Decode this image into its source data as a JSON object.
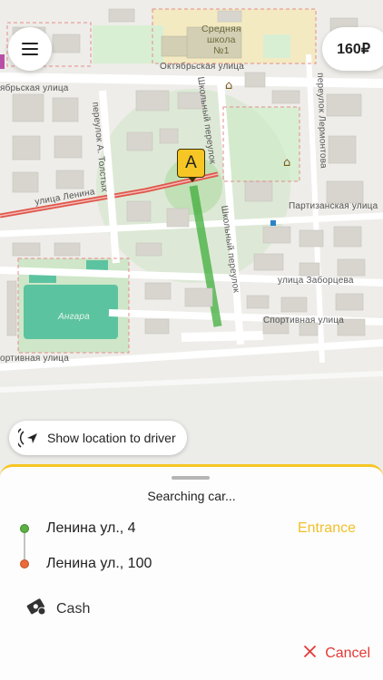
{
  "map": {
    "streets": {
      "oktyabrskaya": "Октябрьская улица",
      "oktyabrskaya_left": "ябрьская улица",
      "shkolny_top": "Школьный переулок",
      "shkolny_bottom": "Школьный переулок",
      "lermontova": "переулок Лермонтова",
      "tolstykh": "переулок А. Толстых",
      "lenina": "улица Ленина",
      "partizanskaya": "Партизанская улица",
      "zaboritseva": "улица Заборцева",
      "sportivnaya": "Спортивная улица",
      "bottom_left": "ортивная улица"
    },
    "school": [
      "Средняя",
      "школа",
      "№1"
    ],
    "stadium": "Ангара"
  },
  "header": {
    "price": "160₽"
  },
  "show_location": {
    "label": "Show location to driver"
  },
  "marker": {
    "letter": "A"
  },
  "sheet": {
    "status": "Searching car...",
    "from_address": "Ленина ул., 4",
    "to_address": "Ленина ул., 100",
    "entrance_label": "Entrance",
    "payment_label": "Cash",
    "cancel_label": "Cancel"
  },
  "colors": {
    "accent": "#f6c624",
    "cancel": "#e53935",
    "origin_dot": "#5bb043",
    "destination_dot": "#ea6a3a"
  }
}
